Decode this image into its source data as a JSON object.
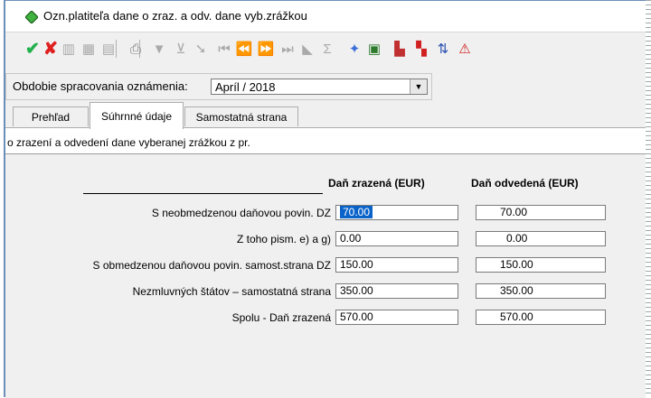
{
  "window": {
    "title": "Ozn.platiteľa dane o zraz. a odv. dane vyb.zrážkou"
  },
  "toolbar": {
    "buttons": [
      {
        "name": "confirm-icon",
        "glyph": "✔",
        "color": "#22b14c",
        "enabled": true
      },
      {
        "name": "cancel-icon",
        "glyph": "✘",
        "color": "#e02020",
        "enabled": true
      },
      {
        "name": "grid-icon",
        "glyph": "▥",
        "color": "#a9a9a9",
        "enabled": false
      },
      {
        "name": "grid-add-icon",
        "glyph": "▦",
        "color": "#a9a9a9",
        "enabled": false
      },
      {
        "name": "document-icon",
        "glyph": "▤",
        "color": "#a9a9a9",
        "enabled": false
      },
      {
        "name": "print-icon",
        "glyph": "⎙",
        "color": "#808080",
        "enabled": true
      },
      {
        "name": "filter-icon",
        "glyph": "▼",
        "color": "#a9a9a9",
        "enabled": false
      },
      {
        "name": "filter-remove-icon",
        "glyph": "⊻",
        "color": "#a9a9a9",
        "enabled": false
      },
      {
        "name": "marker-icon",
        "glyph": "➘",
        "color": "#a9a9a9",
        "enabled": false
      },
      {
        "name": "first-record-icon",
        "glyph": "⏮",
        "color": "#a9a9a9",
        "enabled": false
      },
      {
        "name": "previous-record-icon",
        "glyph": "⏪",
        "color": "#a9a9a9",
        "enabled": false
      },
      {
        "name": "next-record-icon",
        "glyph": "⏩",
        "color": "#a9a9a9",
        "enabled": false
      },
      {
        "name": "last-record-icon",
        "glyph": "⏭",
        "color": "#a9a9a9",
        "enabled": false
      },
      {
        "name": "bookmark-icon",
        "glyph": "◣",
        "color": "#a9a9a9",
        "enabled": false
      },
      {
        "name": "sum-icon",
        "glyph": "Σ",
        "color": "#a9a9a9",
        "enabled": false
      },
      {
        "name": "wizard-icon",
        "glyph": "✦",
        "color": "#3a6fd8",
        "enabled": true
      },
      {
        "name": "calendar-icon",
        "glyph": "▣",
        "color": "#2c7a2c",
        "enabled": true
      },
      {
        "name": "chart-icon",
        "glyph": "▙",
        "color": "#c03030",
        "enabled": true
      },
      {
        "name": "export-icon",
        "glyph": "▚",
        "color": "#d02020",
        "enabled": true
      },
      {
        "name": "transfer-icon",
        "glyph": "⇅",
        "color": "#2a4fb0",
        "enabled": true
      },
      {
        "name": "pdf-icon",
        "glyph": "⚠",
        "color": "#d01818",
        "enabled": true
      }
    ]
  },
  "period": {
    "label": "Obdobie spracovania oznámenia:",
    "value": "Apríl / 2018"
  },
  "tabs": [
    {
      "label": "Prehľad",
      "active": false
    },
    {
      "label": "Súhrnné údaje",
      "active": true
    },
    {
      "label": "Samostatná strana",
      "active": false
    }
  ],
  "panel": {
    "heading": "o zrazení a odvedení dane vyberanej zrážkou z pr."
  },
  "table": {
    "columns": [
      "Daň zrazená (EUR)",
      "Daň odvedená (EUR)"
    ],
    "rows": [
      {
        "label": "S neobmedzenou daňovou povin. DZ",
        "withheld": "70.00",
        "paid": "70.00"
      },
      {
        "label": "Z toho pism. e)  a g)",
        "withheld": "0.00",
        "paid": "0.00"
      },
      {
        "label": "S obmedzenou daňovou povin. samost.strana DZ",
        "withheld": "150.00",
        "paid": "150.00"
      },
      {
        "label": "Nezmluvných štátov – samostatná strana",
        "withheld": "350.00",
        "paid": "350.00"
      },
      {
        "label": "Spolu - Daň zrazená",
        "withheld": "570.00",
        "paid": "570.00"
      }
    ]
  }
}
